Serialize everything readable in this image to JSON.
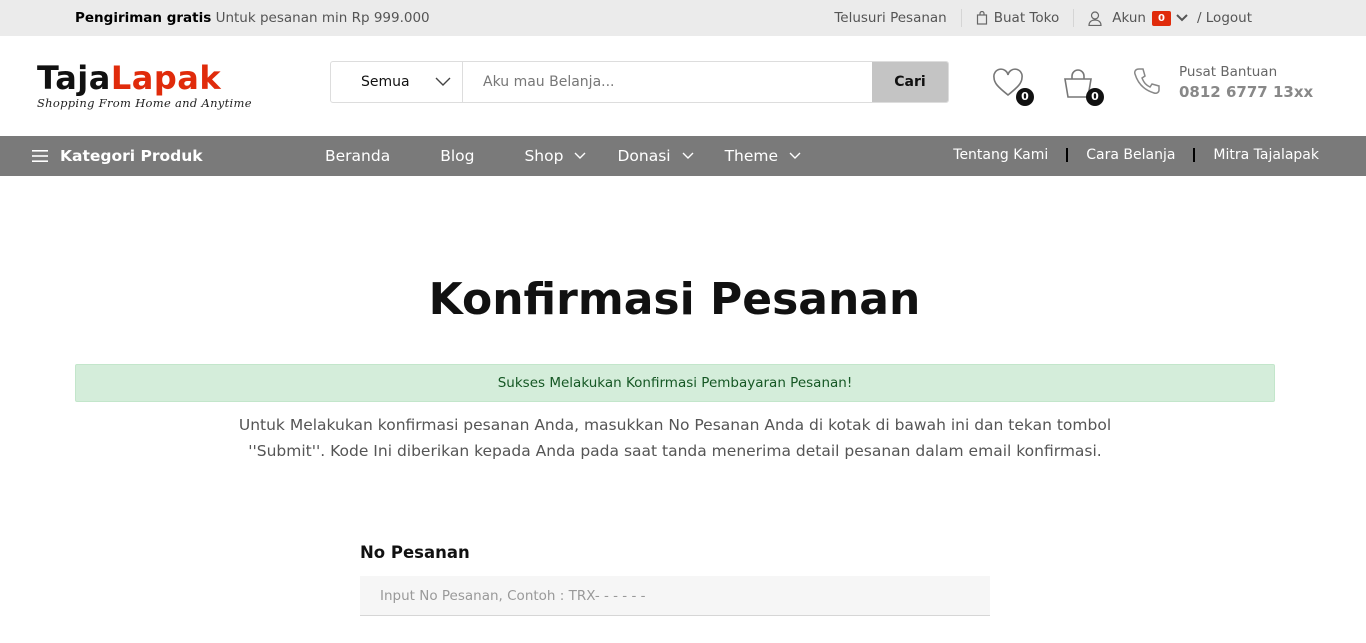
{
  "topbar": {
    "shipping_bold": "Pengiriman gratis",
    "shipping_text": "Untuk pesanan min Rp 999.000",
    "track_order": "Telusuri Pesanan",
    "create_store": "Buat Toko",
    "account": "Akun",
    "account_badge": "0",
    "logout": "/ Logout"
  },
  "header": {
    "logo_dark": "Taja",
    "logo_red": "Lapak",
    "logo_tagline": "Shopping From Home and Anytime",
    "search_category": "Semua",
    "search_placeholder": "Aku mau Belanja...",
    "search_button": "Cari",
    "wishlist_count": "0",
    "cart_count": "0",
    "help_title": "Pusat Bantuan",
    "help_phone": "0812 6777 13xx"
  },
  "nav": {
    "categories": "Kategori Produk",
    "items": [
      {
        "label": "Beranda"
      },
      {
        "label": "Blog"
      },
      {
        "label": "Shop"
      },
      {
        "label": "Donasi"
      },
      {
        "label": "Theme"
      }
    ],
    "right_items": [
      {
        "label": "Tentang Kami"
      },
      {
        "label": "Cara Belanja"
      },
      {
        "label": "Mitra Tajalapak"
      }
    ]
  },
  "main": {
    "title": "Konfirmasi Pesanan",
    "alert": "Sukses Melakukan Konfirmasi Pembayaran Pesanan!",
    "description": "Untuk Melakukan konfirmasi pesanan Anda, masukkan No Pesanan Anda di kotak di bawah ini dan tekan tombol ''Submit''. Kode Ini diberikan kepada Anda pada saat tanda menerima detail pesanan dalam email konfirmasi.",
    "field_label": "No Pesanan",
    "field_placeholder": "Input No Pesanan, Contoh : TRX- - - - - -"
  },
  "colors": {
    "brand_red": "#e02b0b",
    "nav_bg": "#7a7a7a",
    "alert_bg": "#d4edda",
    "alert_text": "#155724"
  },
  "icons": [
    "bag-icon",
    "user-icon",
    "chevron-down-icon",
    "heart-icon",
    "cart-icon",
    "phone-icon",
    "hamburger-icon"
  ]
}
